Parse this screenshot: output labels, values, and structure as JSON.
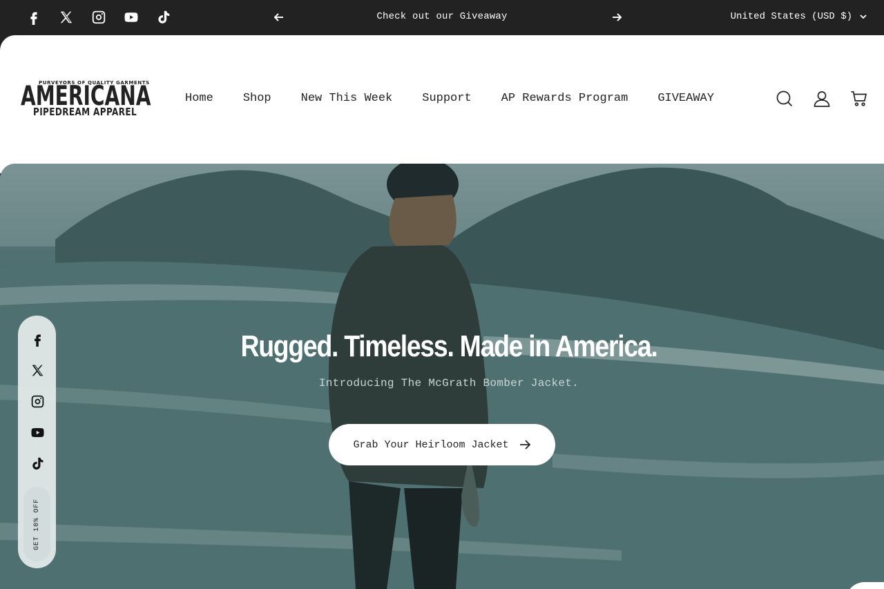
{
  "topbar": {
    "social_icons": [
      "facebook-icon",
      "x-icon",
      "instagram-icon",
      "youtube-icon",
      "tiktok-icon"
    ],
    "announcement": "Check out our Giveaway",
    "currency": "United States (USD $)"
  },
  "header": {
    "logo_top": "PURVEYORS OF QUALITY GARMENTS",
    "logo_main": "AMERICANA",
    "logo_sub": "PIPEDREAM APPAREL",
    "nav": [
      "Home",
      "Shop",
      "New This Week",
      "Support",
      "AP Rewards Program",
      "GIVEAWAY"
    ],
    "icons": [
      "search-icon",
      "account-icon",
      "cart-icon"
    ]
  },
  "hero": {
    "title": "Rugged. Timeless. Made in America.",
    "subtitle": "Introducing The McGrath Bomber Jacket.",
    "cta_label": "Grab Your Heirloom Jacket"
  },
  "rail": {
    "social_icons": [
      "facebook-icon",
      "x-icon",
      "instagram-icon",
      "youtube-icon",
      "tiktok-icon"
    ],
    "discount_label": "GET 10% OFF"
  },
  "colors": {
    "topbar_bg": "#222222",
    "hero_tint": "#4e6e70",
    "text_dark": "#222222"
  }
}
